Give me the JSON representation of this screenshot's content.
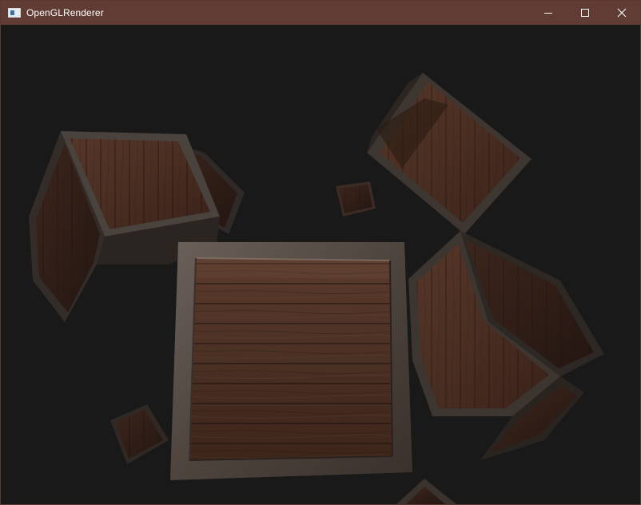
{
  "window": {
    "title": "OpenGLRenderer",
    "titlebar_color": "#613c35",
    "clear_color": "#191919"
  },
  "icons": {
    "app": "app-window-icon",
    "minimize": "minimize-icon",
    "maximize": "maximize-icon",
    "close": "close-icon"
  },
  "scene": {
    "object": "wooden-crate",
    "crate_count": 9,
    "wood_color": "#4a2e22",
    "frame_color": "#5c514a"
  }
}
